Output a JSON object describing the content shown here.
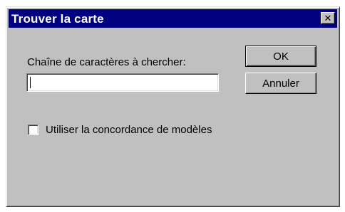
{
  "window": {
    "title": "Trouver la carte",
    "close_glyph": "✕"
  },
  "form": {
    "search_label": "Chaîne de caractères à chercher:",
    "search_value": "",
    "search_placeholder": "",
    "pattern_matching_label": "Utiliser la concordance de modèles",
    "pattern_matching_checked": false
  },
  "buttons": {
    "ok_label": "OK",
    "cancel_label": "Annuler"
  },
  "colors": {
    "titlebar": "#000080",
    "face": "#c0c0c0"
  }
}
